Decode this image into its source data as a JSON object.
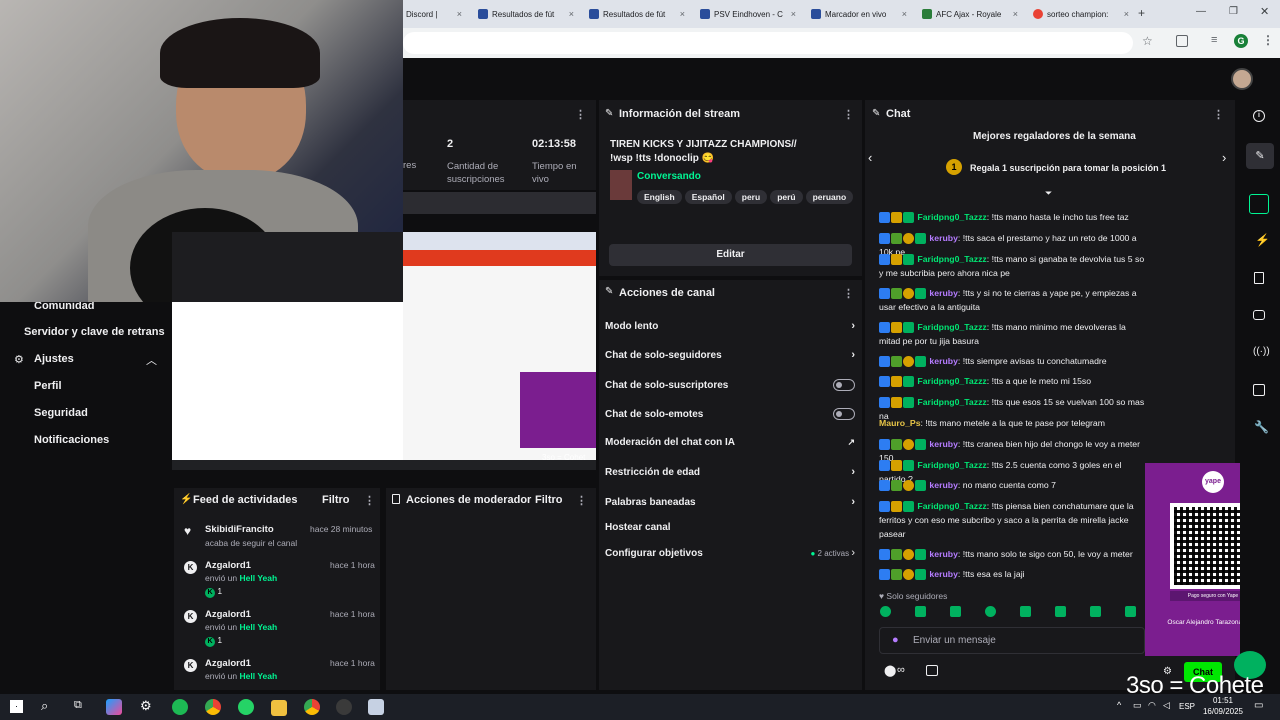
{
  "browser": {
    "tabs": [
      "Discord |",
      "Resultados de fút",
      "Resultados de fút",
      "PSV Eindhoven - C",
      "Marcador en vivo",
      "AFC Ajax - Royale",
      "sorteo champion:"
    ],
    "new_tab": "+",
    "profile_letter": "G"
  },
  "stats": {
    "partial_label": "res",
    "subs_value": "2",
    "subs_label": "Cantidad de suscripciones",
    "live_value": "02:13:58",
    "live_label": "Tiempo en vivo"
  },
  "stream_info": {
    "header": "Información del stream",
    "title": "TIREN KICKS Y JIJITAZZ CHAMPIONS// !wsp !tts !donoclip 😋",
    "category": "Conversando",
    "tags": [
      "English",
      "Español",
      "peru",
      "perú",
      "peruano"
    ],
    "edit_label": "Editar"
  },
  "channel_actions": {
    "header": "Acciones de canal",
    "items": [
      {
        "label": "Modo lento"
      },
      {
        "label": "Chat de solo-seguidores"
      },
      {
        "label": "Chat de solo-suscriptores"
      },
      {
        "label": "Chat de solo-emotes"
      },
      {
        "label": "Moderación del chat con IA"
      },
      {
        "label": "Restricción de edad"
      },
      {
        "label": "Palabras baneadas"
      },
      {
        "label": "Hostear canal"
      },
      {
        "label": "Configurar objetivos"
      }
    ],
    "goals_active": "2 activas"
  },
  "sidebar": {
    "comunidad": "Comunidad",
    "server_key": "Servidor y clave de retrans",
    "settings": "Ajustes",
    "profile": "Perfil",
    "security": "Seguridad",
    "notifications": "Notificaciones"
  },
  "activity_feed": {
    "header": "Feed de actividades",
    "filter": "Filtro",
    "items": [
      {
        "name": "SkibidiFrancito",
        "time": "hace 28 minutos",
        "desc": "acaba de seguir el canal",
        "gift": "",
        "count": ""
      },
      {
        "name": "Azgalord1",
        "time": "hace 1 hora",
        "desc": "envió un",
        "gift": "Hell Yeah",
        "count": "1"
      },
      {
        "name": "Azgalord1",
        "time": "hace 1 hora",
        "desc": "envió un",
        "gift": "Hell Yeah",
        "count": "1"
      },
      {
        "name": "Azgalord1",
        "time": "hace 1 hora",
        "desc": "envió un",
        "gift": "Hell Yeah",
        "count": ""
      }
    ]
  },
  "mod_actions": {
    "header": "Acciones de moderador",
    "filter": "Filtro"
  },
  "chat": {
    "header": "Chat",
    "top_gifters_title": "Mejores regaladores de la semana",
    "top_gifters_rank": "1",
    "top_gifters_cta": "Regala 1 suscripción para tomar la posición 1",
    "messages": [
      {
        "user": "Faridpng0_Tazzz",
        "color": "#00e673",
        "text": ": !tts mano hasta le incho tus free taz"
      },
      {
        "user": "keruby",
        "color": "#b57cff",
        "text": ": !tts saca el prestamo y haz un reto de 1000 a 10k pe"
      },
      {
        "user": "Faridpng0_Tazzz",
        "color": "#00e673",
        "text": ": !tts mano si ganaba te devolvia tus 5 so y me subcribia pero ahora nica pe"
      },
      {
        "user": "keruby",
        "color": "#b57cff",
        "text": ": !tts y si no te cierras a yape pe, y empiezas a usar efectivo a la antiguita"
      },
      {
        "user": "Faridpng0_Tazzz",
        "color": "#00e673",
        "text": ": !tts mano minimo me devolveras la mitad pe por tu jija basura"
      },
      {
        "user": "keruby",
        "color": "#b57cff",
        "text": ": !tts siempre avisas tu conchatumadre"
      },
      {
        "user": "Faridpng0_Tazzz",
        "color": "#00e673",
        "text": ": !tts a que le meto mi 15so"
      },
      {
        "user": "Faridpng0_Tazzz",
        "color": "#00e673",
        "text": ": !tts que esos 15 se vuelvan 100 so mas na"
      },
      {
        "user": "Mauro_Ps",
        "color": "#e8c547",
        "text": ": !tts mano metele a la que te pase por telegram"
      },
      {
        "user": "keruby",
        "color": "#b57cff",
        "text": ": !tts cranea bien hijo del chongo le voy a meter 150"
      },
      {
        "user": "Faridpng0_Tazzz",
        "color": "#00e673",
        "text": ": !tts 2.5 cuenta como 3 goles en el partido ?"
      },
      {
        "user": "keruby",
        "color": "#b57cff",
        "text": ": no mano cuenta como 7"
      },
      {
        "user": "Faridpng0_Tazzz",
        "color": "#00e673",
        "text": ": !tts piensa bien conchatumare que la ferritos y con eso me subcribo y saco a la perrita de mirella jacke pasear"
      },
      {
        "user": "keruby",
        "color": "#b57cff",
        "text": ": !tts mano solo te sigo con 50, le voy a meter"
      },
      {
        "user": "keruby",
        "color": "#b57cff",
        "text": ": !tts esa es la jaji"
      }
    ],
    "followers_only": "Solo seguidores",
    "input_placeholder": "Enviar un mensaje",
    "infinity": "∞",
    "send_label": "Chat"
  },
  "overlay": {
    "qr_caption": "Oscar Alejandro Tarazona Veliz",
    "qr_small": "Pago seguro con Yape",
    "yape_label": "yape",
    "ticker": "3so = Cohete",
    "mini_ticker": "3so = Cohet"
  },
  "taskbar": {
    "time": "01:51",
    "date": "16/09/2025",
    "lang": "ESP"
  }
}
